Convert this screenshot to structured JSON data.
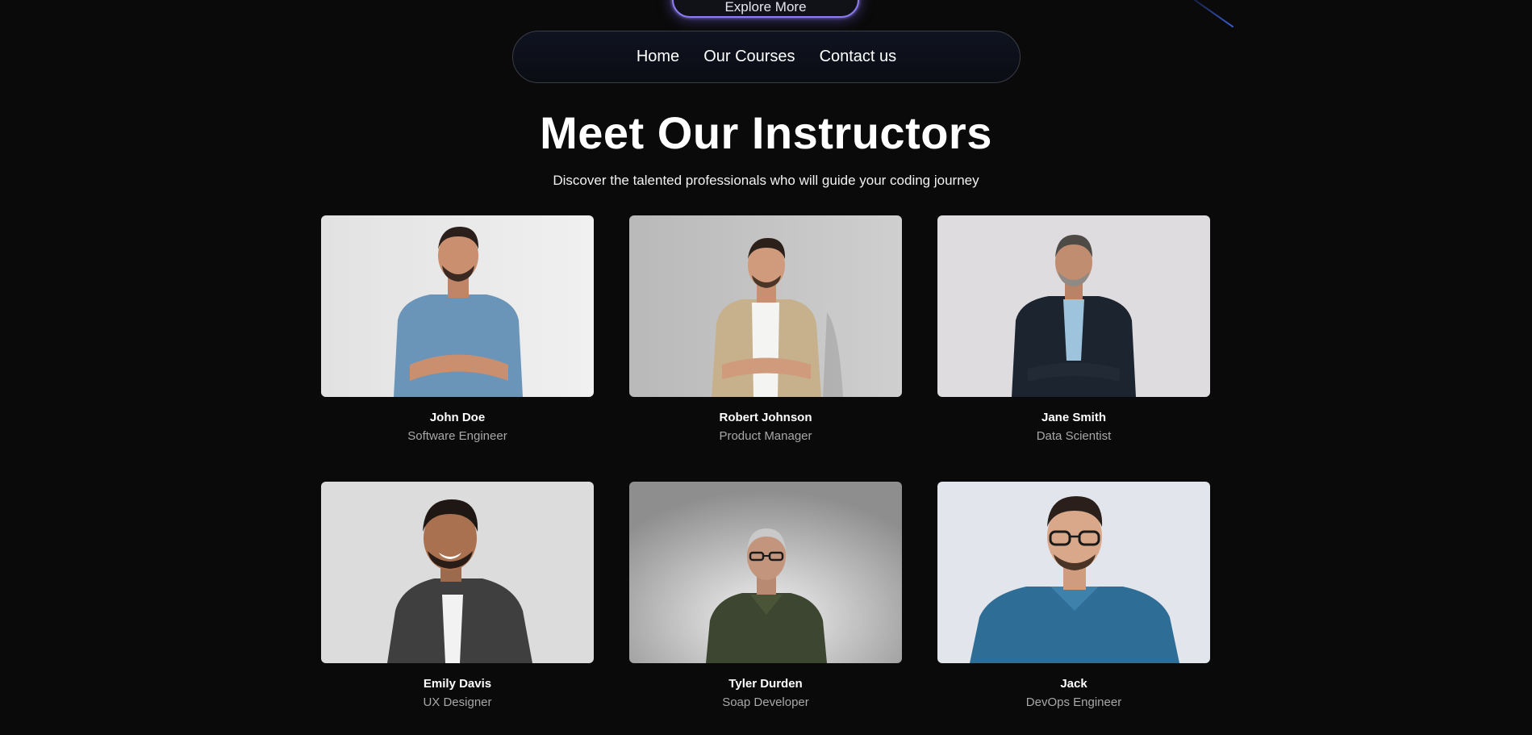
{
  "hero": {
    "explore_label": "Explore More"
  },
  "nav": {
    "items": [
      {
        "label": "Home"
      },
      {
        "label": "Our Courses"
      },
      {
        "label": "Contact us"
      }
    ]
  },
  "section": {
    "title": "Meet Our Instructors",
    "subtitle": "Discover the talented professionals who will guide your coding journey"
  },
  "instructors": [
    {
      "name": "John Doe",
      "role": "Software Engineer",
      "photo": "man-blue-tshirt-arms-crossed"
    },
    {
      "name": "Robert Johnson",
      "role": "Product Manager",
      "photo": "man-beige-shirt-arms-crossed"
    },
    {
      "name": "Jane Smith",
      "role": "Data Scientist",
      "photo": "man-navy-suit-arms-crossed"
    },
    {
      "name": "Emily Davis",
      "role": "UX Designer",
      "photo": "man-dark-shirt-smiling"
    },
    {
      "name": "Tyler Durden",
      "role": "Soap Developer",
      "photo": "older-man-olive-polo-glasses"
    },
    {
      "name": "Jack",
      "role": "DevOps Engineer",
      "photo": "man-blue-check-shirt-glasses"
    }
  ],
  "colors": {
    "background": "#0a0a0a",
    "accent_glow": "#8b7cf0",
    "role_text": "#a8a8a8"
  }
}
